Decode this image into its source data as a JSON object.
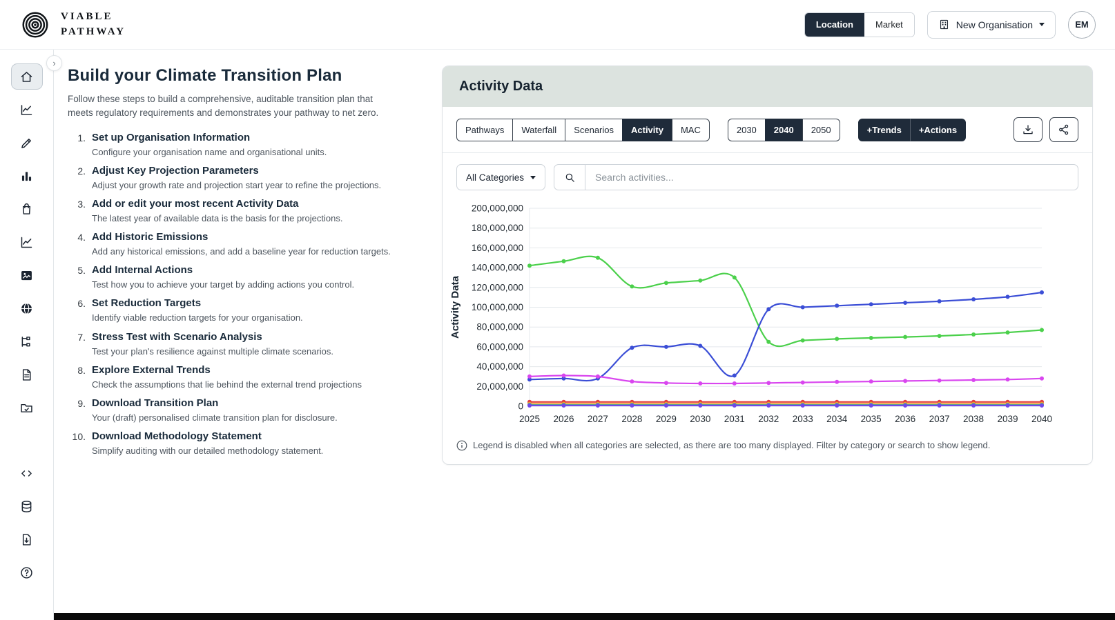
{
  "brand": {
    "line1": "VIABLE",
    "line2": "PATHWAY"
  },
  "header": {
    "location_label": "Location",
    "market_label": "Market",
    "organisation": "New Organisation",
    "avatar_initials": "EM"
  },
  "sidebar": {
    "icons": [
      "home-icon",
      "line-chart-icon",
      "pencil-icon",
      "bar-chart-icon",
      "shopping-bag-icon",
      "area-chart-icon",
      "image-icon",
      "globe-icon",
      "flow-icon",
      "document-icon",
      "folder-check-icon",
      "code-icon",
      "database-icon",
      "file-download-icon",
      "help-icon"
    ]
  },
  "steps_panel": {
    "title": "Build your Climate Transition Plan",
    "subtitle": "Follow these steps to build a comprehensive, auditable transition plan that meets regulatory requirements and demonstrates your pathway to net zero.",
    "items": [
      {
        "num": "1.",
        "title": "Set up Organisation Information",
        "desc": "Configure your organisation name and organisational units."
      },
      {
        "num": "2.",
        "title": "Adjust Key Projection Parameters",
        "desc": "Adjust your growth rate and projection start year to refine the projections."
      },
      {
        "num": "3.",
        "title": "Add or edit your most recent Activity Data",
        "desc": "The latest year of available data is the basis for the projections."
      },
      {
        "num": "4.",
        "title": "Add Historic Emissions",
        "desc": "Add any historical emissions, and add a baseline year for reduction targets."
      },
      {
        "num": "5.",
        "title": "Add Internal Actions",
        "desc": "Test how you to achieve your target by adding actions you control."
      },
      {
        "num": "6.",
        "title": "Set Reduction Targets",
        "desc": "Identify viable reduction targets for your organisation."
      },
      {
        "num": "7.",
        "title": "Stress Test with Scenario Analysis",
        "desc": "Test your plan's resilience against multiple climate scenarios."
      },
      {
        "num": "8.",
        "title": "Explore External Trends",
        "desc": "Check the assumptions that lie behind the external trend projections"
      },
      {
        "num": "9.",
        "title": "Download Transition Plan",
        "desc": "Your (draft) personalised climate transition plan for disclosure."
      },
      {
        "num": "10.",
        "title": "Download Methodology Statement",
        "desc": "Simplify auditing with our detailed methodology statement."
      }
    ]
  },
  "activity_card": {
    "title": "Activity Data",
    "view_tabs": [
      "Pathways",
      "Waterfall",
      "Scenarios",
      "Activity",
      "MAC"
    ],
    "active_view": "Activity",
    "year_tabs": [
      "2030",
      "2040",
      "2050"
    ],
    "active_year": "2040",
    "overlay_buttons": [
      "+Trends",
      "+Actions"
    ],
    "category_dropdown": "All Categories",
    "search_placeholder": "Search activities...",
    "footnote": "Legend is disabled when all categories are selected, as there are too many displayed. Filter by category or search to show legend."
  },
  "chart_data": {
    "type": "line",
    "ylabel": "Activity Data",
    "x": [
      2025,
      2026,
      2027,
      2028,
      2029,
      2030,
      2031,
      2032,
      2033,
      2034,
      2035,
      2036,
      2037,
      2038,
      2039,
      2040
    ],
    "ylim": [
      0,
      200000000
    ],
    "ytick_step": 20000000,
    "grid": true,
    "legend": "hidden",
    "series": [
      {
        "name": "green",
        "color": "#4bd04b",
        "values": [
          142000000,
          146500000,
          150000000,
          121000000,
          124500000,
          127000000,
          130000000,
          65000000,
          66500000,
          68000000,
          69000000,
          70000000,
          71000000,
          72500000,
          74500000,
          77000000
        ]
      },
      {
        "name": "blue",
        "color": "#3b4ed6",
        "values": [
          27000000,
          28000000,
          28000000,
          59000000,
          60000000,
          61000000,
          31000000,
          98000000,
          100000000,
          101500000,
          103000000,
          104500000,
          106000000,
          108000000,
          110500000,
          115000000
        ]
      },
      {
        "name": "magenta",
        "color": "#d946ef",
        "values": [
          30000000,
          31000000,
          30000000,
          25000000,
          23500000,
          23000000,
          23000000,
          23500000,
          24000000,
          24500000,
          25000000,
          25500000,
          26000000,
          26500000,
          27000000,
          28000000
        ]
      },
      {
        "name": "red",
        "color": "#e23c3c",
        "values": [
          4300000,
          4300000,
          4300000,
          4300000,
          4300000,
          4300000,
          4300000,
          4300000,
          4300000,
          4300000,
          4300000,
          4300000,
          4300000,
          4300000,
          4300000,
          4300000
        ]
      },
      {
        "name": "orange",
        "color": "#f0a030",
        "values": [
          2400000,
          2400000,
          2400000,
          2400000,
          2400000,
          2400000,
          2400000,
          2400000,
          2400000,
          2400000,
          2400000,
          2400000,
          2400000,
          2400000,
          2400000,
          2400000
        ]
      },
      {
        "name": "teal",
        "color": "#20b2aa",
        "values": [
          1200000,
          1200000,
          1200000,
          1200000,
          1200000,
          1200000,
          1200000,
          1200000,
          1200000,
          1200000,
          1200000,
          1200000,
          1200000,
          1200000,
          1200000,
          1200000
        ]
      },
      {
        "name": "purple",
        "color": "#7048e8",
        "values": [
          700000,
          700000,
          700000,
          700000,
          700000,
          700000,
          700000,
          700000,
          700000,
          700000,
          700000,
          700000,
          700000,
          700000,
          700000,
          700000
        ]
      }
    ]
  }
}
